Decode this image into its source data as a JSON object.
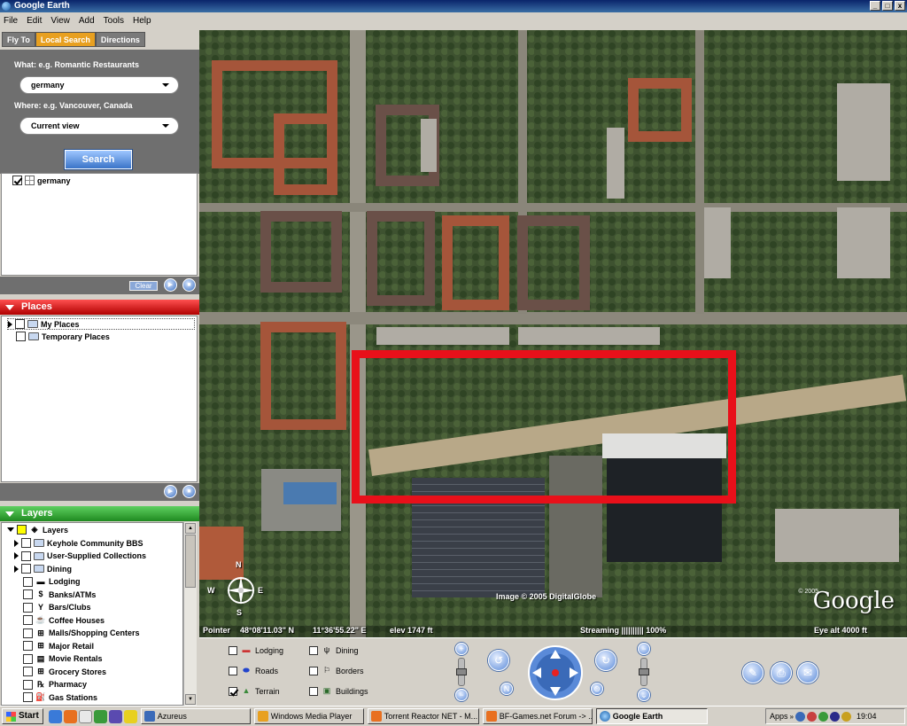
{
  "window": {
    "title": "Google Earth",
    "minimize": "_",
    "maximize": "□",
    "close": "x"
  },
  "menu": [
    "File",
    "Edit",
    "View",
    "Add",
    "Tools",
    "Help"
  ],
  "tabs": {
    "fly_to": "Fly To",
    "local_search": "Local Search",
    "directions": "Directions"
  },
  "search": {
    "what_label": "What: e.g. Romantic Restaurants",
    "what_value": "germany",
    "where_label": "Where: e.g. Vancouver, Canada",
    "where_value": "Current view",
    "button": "Search"
  },
  "results": [
    {
      "label": "germany",
      "checked": true
    }
  ],
  "clear_label": "Clear",
  "places": {
    "title": "Places",
    "items": [
      {
        "label": "My Places",
        "checked": false
      },
      {
        "label": "Temporary Places",
        "checked": false
      }
    ]
  },
  "layers": {
    "title": "Layers",
    "root": "Layers",
    "items": [
      {
        "label": "Keyhole Community BBS",
        "icon": "folder"
      },
      {
        "label": "User-Supplied Collections",
        "icon": "folder"
      },
      {
        "label": "Dining",
        "icon": "folder"
      },
      {
        "label": "Lodging",
        "icon": "bed"
      },
      {
        "label": "Banks/ATMs",
        "icon": "dollar"
      },
      {
        "label": "Bars/Clubs",
        "icon": "glass"
      },
      {
        "label": "Coffee Houses",
        "icon": "cup"
      },
      {
        "label": "Malls/Shopping Centers",
        "icon": "cart"
      },
      {
        "label": "Major Retail",
        "icon": "cart"
      },
      {
        "label": "Movie Rentals",
        "icon": "film"
      },
      {
        "label": "Grocery Stores",
        "icon": "cart"
      },
      {
        "label": "Pharmacy",
        "icon": "rx"
      },
      {
        "label": "Gas Stations",
        "icon": "pump"
      }
    ]
  },
  "map": {
    "copyright": "Image © 2005 DigitalGlobe",
    "logo": "Google",
    "logo_year": "© 2005",
    "pointer_label": "Pointer",
    "pointer_lat": "48°08'11.03\" N",
    "pointer_lon": "11°36'55.22\" E",
    "elev": "elev 1747 ft",
    "streaming": "Streaming |||||||||| 100%",
    "eye_alt": "Eye alt 4000 ft",
    "compass_n": "N",
    "compass_s": "S",
    "compass_e": "E",
    "compass_w": "W",
    "highlight_color": "#e8101a"
  },
  "nav_layers": [
    {
      "label": "Lodging",
      "checked": false
    },
    {
      "label": "Dining",
      "checked": false
    },
    {
      "label": "Roads",
      "checked": false
    },
    {
      "label": "Borders",
      "checked": false
    },
    {
      "label": "Terrain",
      "checked": true
    },
    {
      "label": "Buildings",
      "checked": false
    }
  ],
  "taskbar": {
    "start": "Start",
    "tasks": [
      {
        "label": "Azureus",
        "active": false
      },
      {
        "label": "Windows Media Player",
        "active": false
      },
      {
        "label": "Torrent Reactor NET - M...",
        "active": false
      },
      {
        "label": "BF-Games.net Forum -> ...",
        "active": false
      },
      {
        "label": "Google Earth",
        "active": true
      }
    ],
    "apps_label": "Apps",
    "clock": "19:04"
  }
}
